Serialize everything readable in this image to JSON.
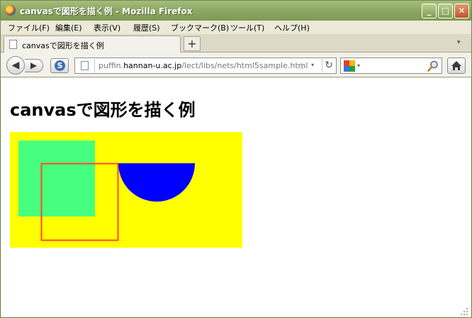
{
  "window": {
    "title": "canvasで図形を描く例 - Mozilla Firefox",
    "minimize_glyph": "_",
    "maximize_glyph": "□",
    "close_glyph": "✕"
  },
  "menu": [
    "ファイル(F)",
    "編集(E)",
    "表示(V)",
    "履歴(S)",
    "ブックマーク(B)",
    "ツール(T)",
    "ヘルプ(H)"
  ],
  "tab": {
    "label": "canvasで図形を描く例",
    "new_tab_glyph": "+",
    "list_glyph": "▾"
  },
  "nav": {
    "back_glyph": "◀",
    "forward_glyph": "▶",
    "url_prefix": "puffin.",
    "url_host": "hannan-u.ac.jp",
    "url_path": "/lect/libs/nets/html5sample.html",
    "star_glyph": "☆",
    "dropdown_glyph": "▾",
    "reload_glyph": "↻",
    "search_value": "",
    "search_placeholder": ""
  },
  "page": {
    "heading": "canvasで図形を描く例"
  },
  "colors": {
    "canvas_background": "#ffff00",
    "green_square": "#47ff7e",
    "red_outline": "#ff4a2a",
    "blue_semicircle": "#0000ff",
    "titlebar": "#8ea964"
  },
  "icons": {
    "browser_logo": "firefox-logo-icon",
    "sync": "s-icon",
    "home": "home-icon",
    "search_engine": "google-icon",
    "search": "magnifier-icon",
    "page": "page-icon"
  }
}
